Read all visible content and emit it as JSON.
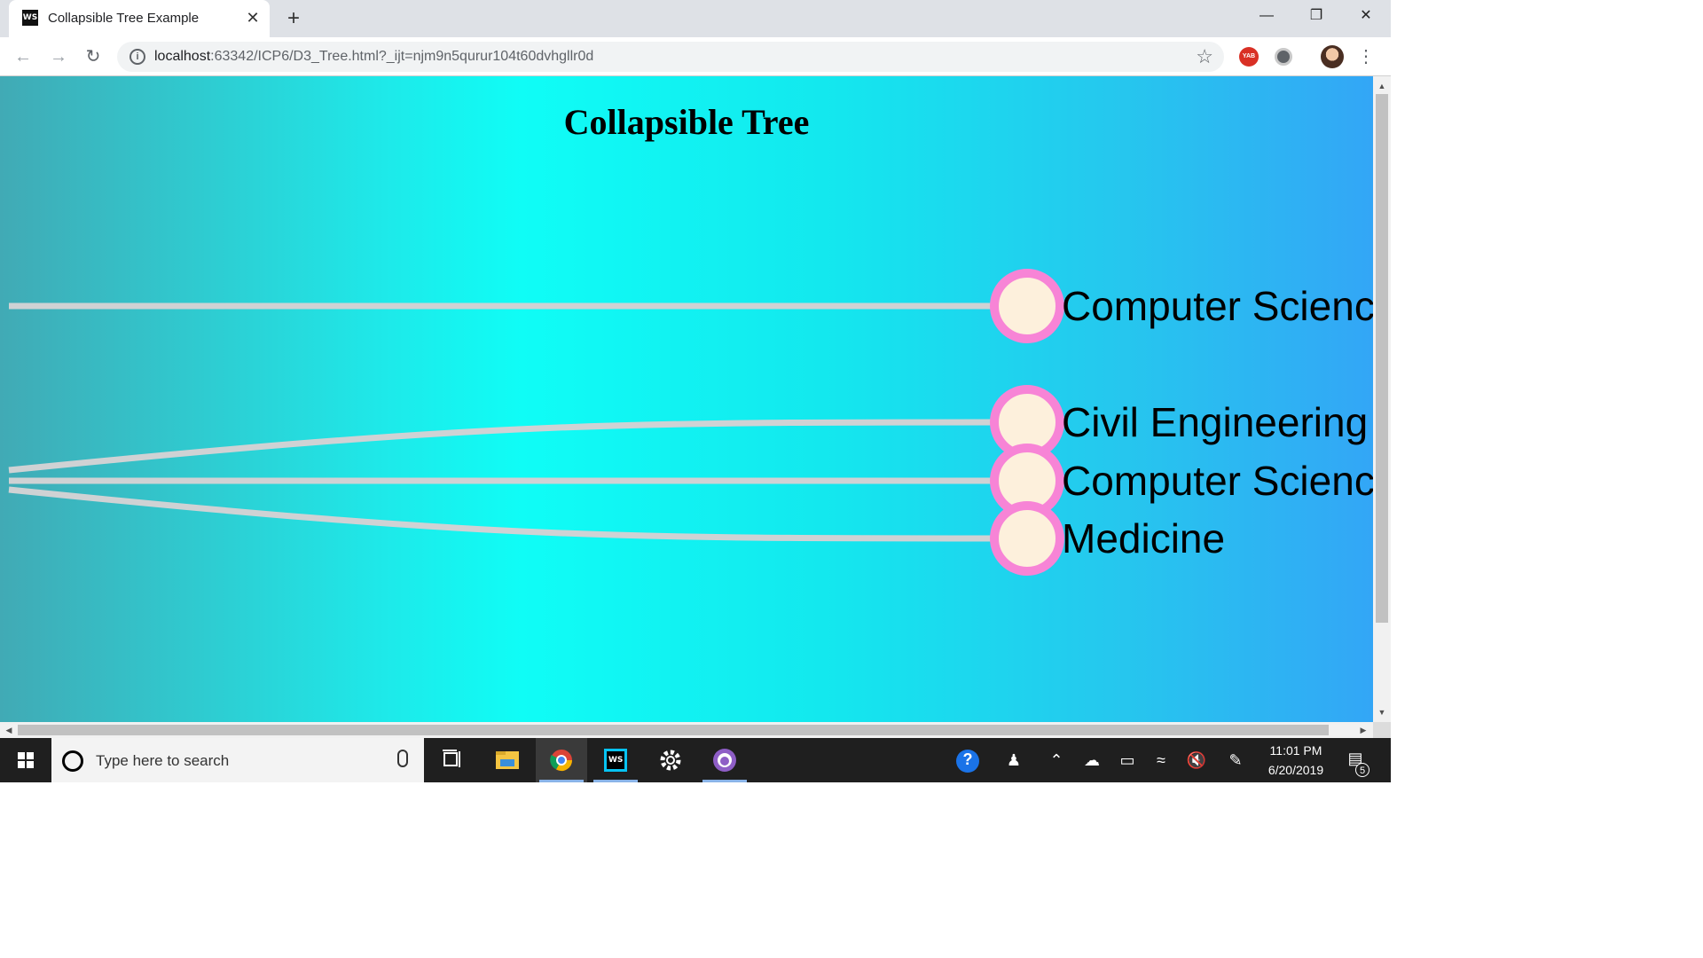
{
  "browser": {
    "tab_title": "Collapsible Tree Example",
    "tab_favicon": "WS",
    "tab_close": "✕",
    "new_tab": "+",
    "window_minimize": "—",
    "window_restore": "❐",
    "window_close": "✕",
    "url_host": "localhost",
    "url_rest": ":63342/ICP6/D3_Tree.html?_ijt=njm9n5qurur104t60dvhgllr0d",
    "extension_badge": "YAB"
  },
  "page": {
    "title": "Collapsible Tree",
    "colors": {
      "link": "#cfd2d4",
      "node_fill": "#fdf0dc",
      "node_stroke": "#f784d6"
    },
    "nodes": [
      {
        "label": "Computer Science"
      },
      {
        "label": "Civil Engineering"
      },
      {
        "label": "Computer Science"
      },
      {
        "label": "Medicine"
      }
    ]
  },
  "taskbar": {
    "search_placeholder": "Type here to search",
    "time": "11:01 PM",
    "date": "6/20/2019",
    "notification_count": "5"
  }
}
